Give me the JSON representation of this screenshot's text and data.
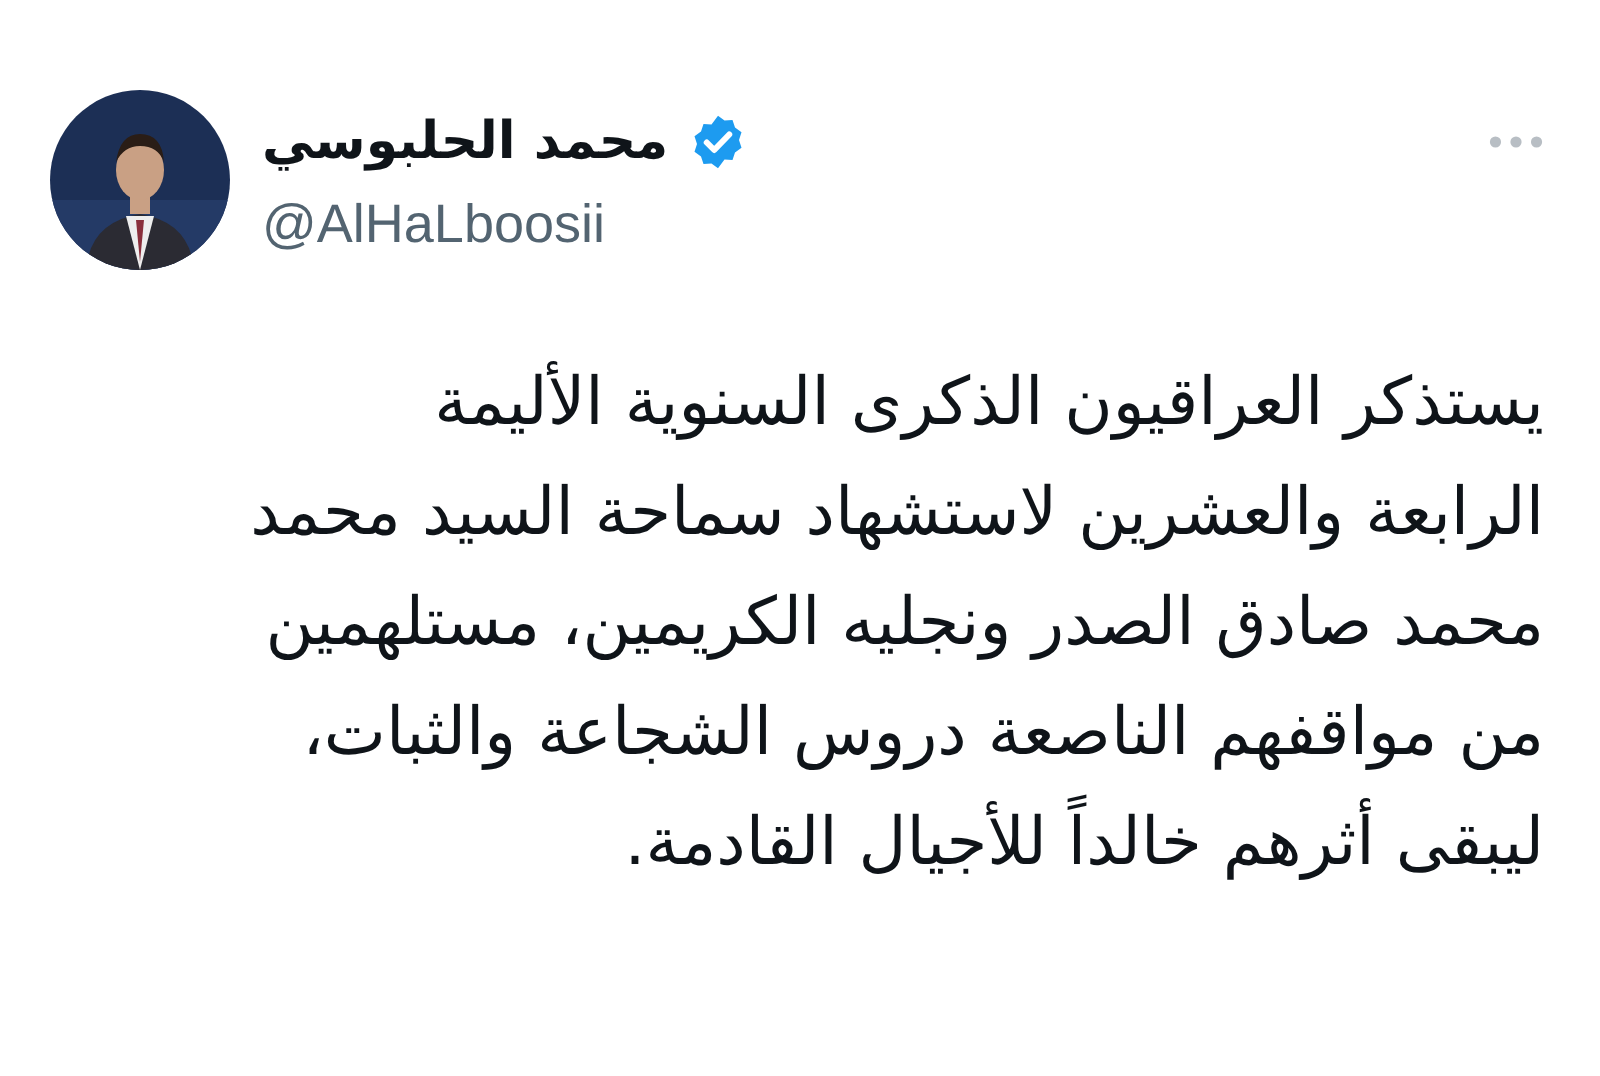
{
  "author": {
    "name": "محمد الحلبوسي",
    "handle": "@AlHaLboosii",
    "verified": true
  },
  "tweet": {
    "text": "يستذكر العراقيون الذكرى السنوية الأليمة الرابعة والعشرين لاستشهاد سماحة السيد محمد محمد صادق الصدر ونجليه الكريمين، مستلهمين من مواقفهم الناصعة دروس الشجاعة والثبات، ليبقى أثرهم خالداً للأجيال القادمة."
  }
}
